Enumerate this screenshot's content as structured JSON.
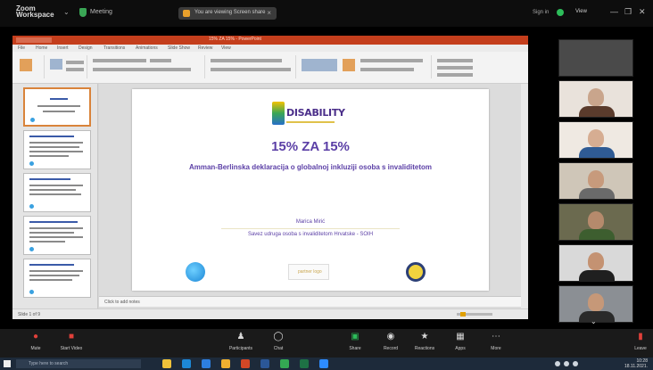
{
  "zoom": {
    "app_title_line1": "Zoom",
    "app_title_line2": "Workspace",
    "meeting_label": "Meeting",
    "share_banner": "You are viewing Screen share",
    "sign_in": "Sign in",
    "view_label": "View",
    "window_controls": [
      "—",
      "❐",
      "✕"
    ]
  },
  "powerpoint": {
    "window_title": "15% ZA 15% - PowerPoint",
    "tabs": [
      "File",
      "Home",
      "Insert",
      "Design",
      "Transitions",
      "Animations",
      "Slide Show",
      "Review",
      "View"
    ],
    "notes_placeholder": "Click to add notes",
    "status_text": "Slide 1 of 9"
  },
  "slide": {
    "logo_word": "DISABILITY",
    "title": "15% ZA 15%",
    "subtitle": "Amman-Berlinska deklaracija o globalnoj inkluziji osoba s invaliditetom",
    "author": "Marica Mirić",
    "organization": "Savez udruga osoba s invaliditetom Hrvatske - SOIH",
    "partner_logo_text": "partner logo"
  },
  "gallery": {
    "more": "⌄",
    "participants": [
      {
        "name": "",
        "bg": "#4a4a4a",
        "face": "#4a4a4a",
        "body": "#4a4a4a"
      },
      {
        "name": "",
        "bg": "#e9e2db",
        "face": "#c9a58c",
        "body": "#5a3b2c"
      },
      {
        "name": "",
        "bg": "#efe9e2",
        "face": "#d6ad92",
        "body": "#2f5b94"
      },
      {
        "name": "",
        "bg": "#cfc6b8",
        "face": "#c79a7c",
        "body": "#6a6a6a"
      },
      {
        "name": "",
        "bg": "#6b6a4f",
        "face": "#b58a6c",
        "body": "#3d5e2f"
      },
      {
        "name": "",
        "bg": "#d9d9d9",
        "face": "#c49272",
        "body": "#1f1f1f"
      },
      {
        "name": "",
        "bg": "#8b8f94",
        "face": "#c69878",
        "body": "#2a2a2a"
      }
    ]
  },
  "toolbar": {
    "items": [
      {
        "label": "Mute",
        "icon": "microphone-icon",
        "color": "#e0403a"
      },
      {
        "label": "Start Video",
        "icon": "camera-icon",
        "color": "#e0403a"
      },
      {
        "label": "Participants",
        "icon": "participants-icon",
        "color": "#d8d8d8"
      },
      {
        "label": "Chat",
        "icon": "chat-icon",
        "color": "#d8d8d8"
      },
      {
        "label": "Share",
        "icon": "share-screen-icon",
        "color": "#2dbd5a"
      },
      {
        "label": "Record",
        "icon": "record-icon",
        "color": "#d8d8d8"
      },
      {
        "label": "Reactions",
        "icon": "reactions-icon",
        "color": "#d8d8d8"
      },
      {
        "label": "Apps",
        "icon": "apps-icon",
        "color": "#d8d8d8"
      },
      {
        "label": "More",
        "icon": "more-icon",
        "color": "#d8d8d8"
      },
      {
        "label": "Leave",
        "icon": "leave-icon",
        "color": "#e0403a"
      }
    ]
  },
  "taskbar": {
    "search_placeholder": "Type here to search",
    "apps": [
      {
        "icon": "explorer-icon",
        "color": "#f0c23a"
      },
      {
        "icon": "edge-icon",
        "color": "#1d88d6"
      },
      {
        "icon": "mail-icon",
        "color": "#2d7fe0"
      },
      {
        "icon": "files-icon",
        "color": "#f0b030"
      },
      {
        "icon": "powerpoint-icon",
        "color": "#d24726"
      },
      {
        "icon": "word-icon",
        "color": "#2b5797"
      },
      {
        "icon": "chrome-icon",
        "color": "#34a853"
      },
      {
        "icon": "excel-icon",
        "color": "#1e7145"
      },
      {
        "icon": "zoom-icon",
        "color": "#2d8cff"
      }
    ],
    "time": "10:28",
    "date": "18.11.2021."
  }
}
